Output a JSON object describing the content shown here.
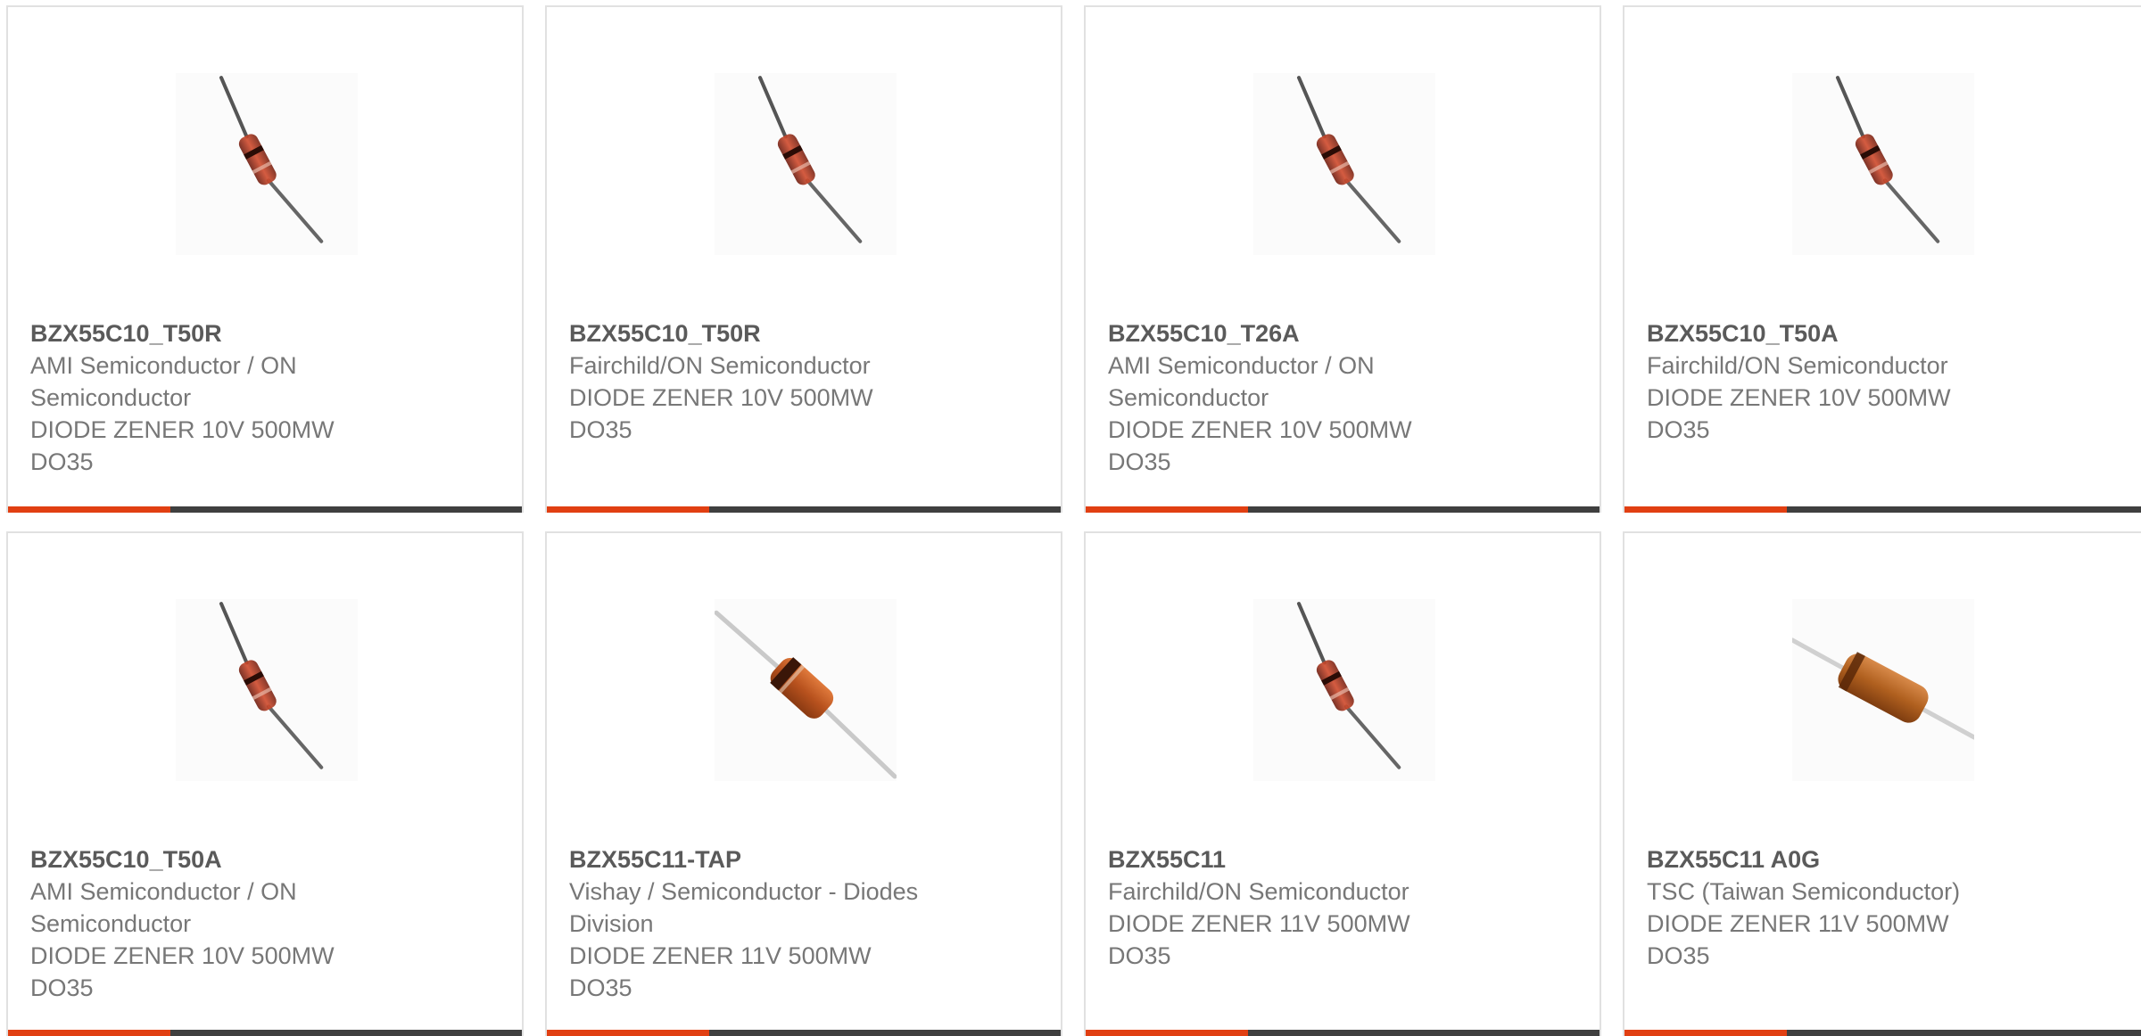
{
  "colors": {
    "accent": "#e13f12",
    "bar": "#3f3f3f",
    "border": "#e1e1e1",
    "text": "#777777",
    "title": "#5a5a5a"
  },
  "products": [
    {
      "part": "BZX55C10_T50R",
      "mfr": "AMI Semiconductor / ON Semiconductor",
      "desc": "DIODE ZENER 10V 500MW",
      "pkg": "DO35",
      "image": "glass-diode-icon"
    },
    {
      "part": "BZX55C10_T50R",
      "mfr": "Fairchild/ON Semiconductor",
      "desc": "DIODE ZENER 10V 500MW",
      "pkg": "DO35",
      "image": "glass-diode-icon"
    },
    {
      "part": "BZX55C10_T26A",
      "mfr": "AMI Semiconductor / ON Semiconductor",
      "desc": "DIODE ZENER 10V 500MW",
      "pkg": "DO35",
      "image": "glass-diode-icon"
    },
    {
      "part": "BZX55C10_T50A",
      "mfr": "Fairchild/ON Semiconductor",
      "desc": "DIODE ZENER 10V 500MW",
      "pkg": "DO35",
      "image": "glass-diode-icon"
    },
    {
      "part": "BZX55C10_T50A",
      "mfr": "AMI Semiconductor / ON Semiconductor",
      "desc": "DIODE ZENER 10V 500MW",
      "pkg": "DO35",
      "image": "glass-diode-icon"
    },
    {
      "part": "BZX55C11-TAP",
      "mfr": "Vishay / Semiconductor - Diodes Division",
      "desc": "DIODE ZENER 11V 500MW",
      "pkg": "DO35",
      "image": "orange-diode-icon"
    },
    {
      "part": "BZX55C11",
      "mfr": "Fairchild/ON Semiconductor",
      "desc": "DIODE ZENER 11V 500MW",
      "pkg": "DO35",
      "image": "glass-diode-icon"
    },
    {
      "part": "BZX55C11 A0G",
      "mfr": "TSC (Taiwan Semiconductor)",
      "desc": "DIODE ZENER 11V 500MW",
      "pkg": "DO35",
      "image": "horizontal-diode-icon"
    }
  ]
}
